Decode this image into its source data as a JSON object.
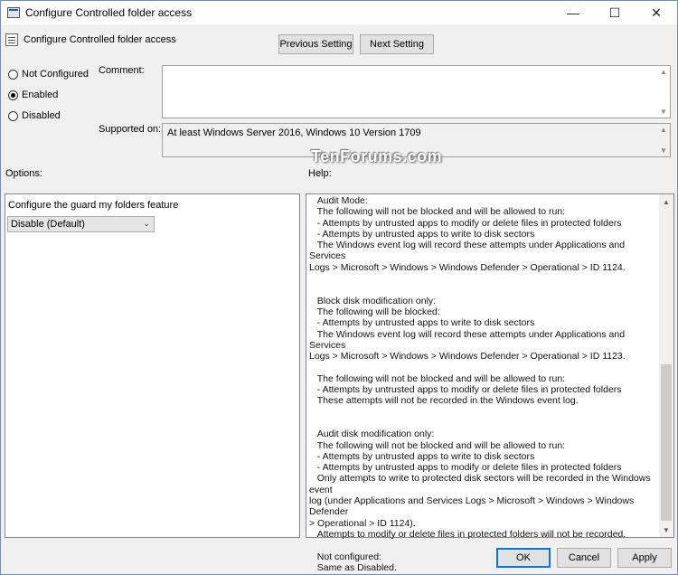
{
  "window": {
    "title": "Configure Controlled folder access",
    "minimize_glyph": "—",
    "maximize_glyph": "☐",
    "close_glyph": "✕"
  },
  "header": {
    "policy_name": "Configure Controlled folder access",
    "previous_label": "Previous Setting",
    "next_label": "Next Setting"
  },
  "state": {
    "options": [
      {
        "label": "Not Configured",
        "checked": false
      },
      {
        "label": "Enabled",
        "checked": true
      },
      {
        "label": "Disabled",
        "checked": false
      }
    ]
  },
  "comment": {
    "label": "Comment:",
    "value": ""
  },
  "supported": {
    "label": "Supported on:",
    "value": "At least Windows Server 2016, Windows 10 Version 1709"
  },
  "options_section": {
    "label": "Options:",
    "feature_label": "Configure the guard my folders feature",
    "selected": "Disable (Default)"
  },
  "help": {
    "label": "Help:",
    "text": "   Audit Mode:\n   The following will not be blocked and will be allowed to run:\n   - Attempts by untrusted apps to modify or delete files in protected folders\n   - Attempts by untrusted apps to write to disk sectors\n   The Windows event log will record these attempts under Applications and Services\nLogs > Microsoft > Windows > Windows Defender > Operational > ID 1124.\n\n\n   Block disk modification only:\n   The following will be blocked:\n   - Attempts by untrusted apps to write to disk sectors\n   The Windows event log will record these attempts under Applications and Services\nLogs > Microsoft > Windows > Windows Defender > Operational > ID 1123.\n\n   The following will not be blocked and will be allowed to run:\n   - Attempts by untrusted apps to modify or delete files in protected folders\n   These attempts will not be recorded in the Windows event log.\n\n\n   Audit disk modification only:\n   The following will not be blocked and will be allowed to run:\n   - Attempts by untrusted apps to write to disk sectors\n   - Attempts by untrusted apps to modify or delete files in protected folders\n   Only attempts to write to protected disk sectors will be recorded in the Windows event\nlog (under Applications and Services Logs > Microsoft > Windows > Windows Defender\n> Operational > ID 1124).\n   Attempts to modify or delete files in protected folders will not be recorded.\n\n   Not configured:\n   Same as Disabled.",
    "scroll_position": 0.95
  },
  "watermark": "TenForums.com",
  "footer": {
    "ok_label": "OK",
    "cancel_label": "Cancel",
    "apply_label": "Apply"
  },
  "colors": {
    "accent": "#0078d7",
    "window_bg": "#f0f0f0"
  }
}
